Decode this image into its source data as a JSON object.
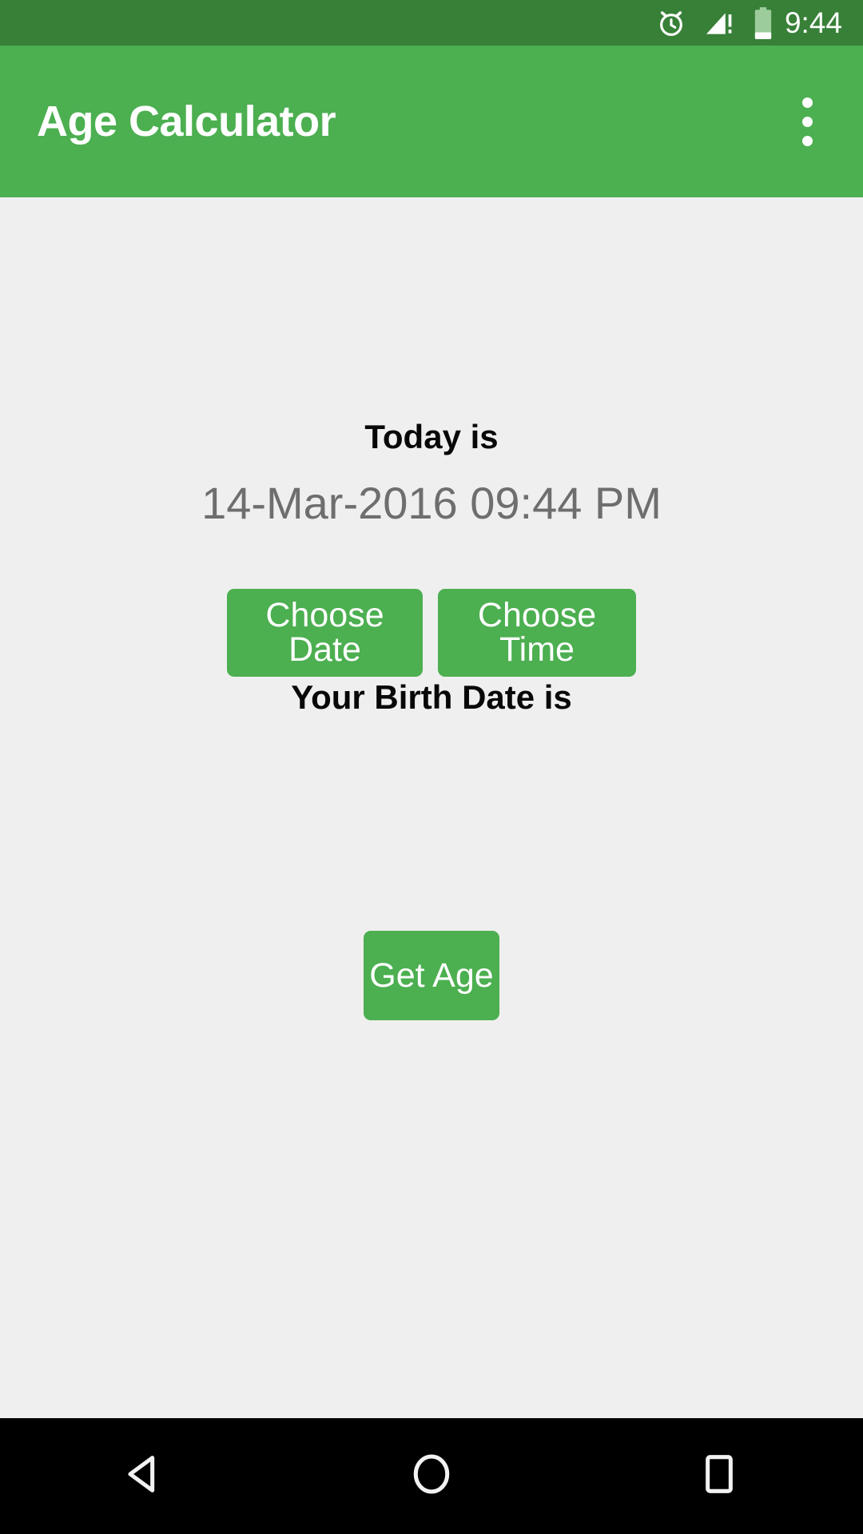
{
  "status_bar": {
    "time": "9:44",
    "icons": [
      {
        "name": "alarm-clock-icon",
        "label": "alarm"
      },
      {
        "name": "signal-no-service-icon",
        "label": "cellular signal warning"
      },
      {
        "name": "battery-icon",
        "label": "battery"
      }
    ],
    "background_color": "#388038",
    "foreground_color": "#ffffff"
  },
  "app_bar": {
    "title": "Age Calculator",
    "overflow_menu_label": "More options",
    "background_color": "#4caf50",
    "title_color": "#ffffff"
  },
  "main": {
    "today_label": "Today is",
    "today_value": "14-Mar-2016 09:44 PM",
    "choose_date_label": "Choose Date",
    "choose_time_label": "Choose Time",
    "birth_date_label": "Your Birth Date is",
    "birth_date_value": "",
    "get_age_label": "Get Age",
    "background_color": "#efefef",
    "heading_color": "#080808",
    "value_color": "#6e6e6e",
    "button_color": "#4caf50",
    "button_text_color": "#ffffff"
  },
  "nav_bar": {
    "back_label": "Back",
    "home_label": "Home",
    "recents_label": "Recents",
    "background_color": "#000000",
    "icon_color": "#ffffff"
  }
}
